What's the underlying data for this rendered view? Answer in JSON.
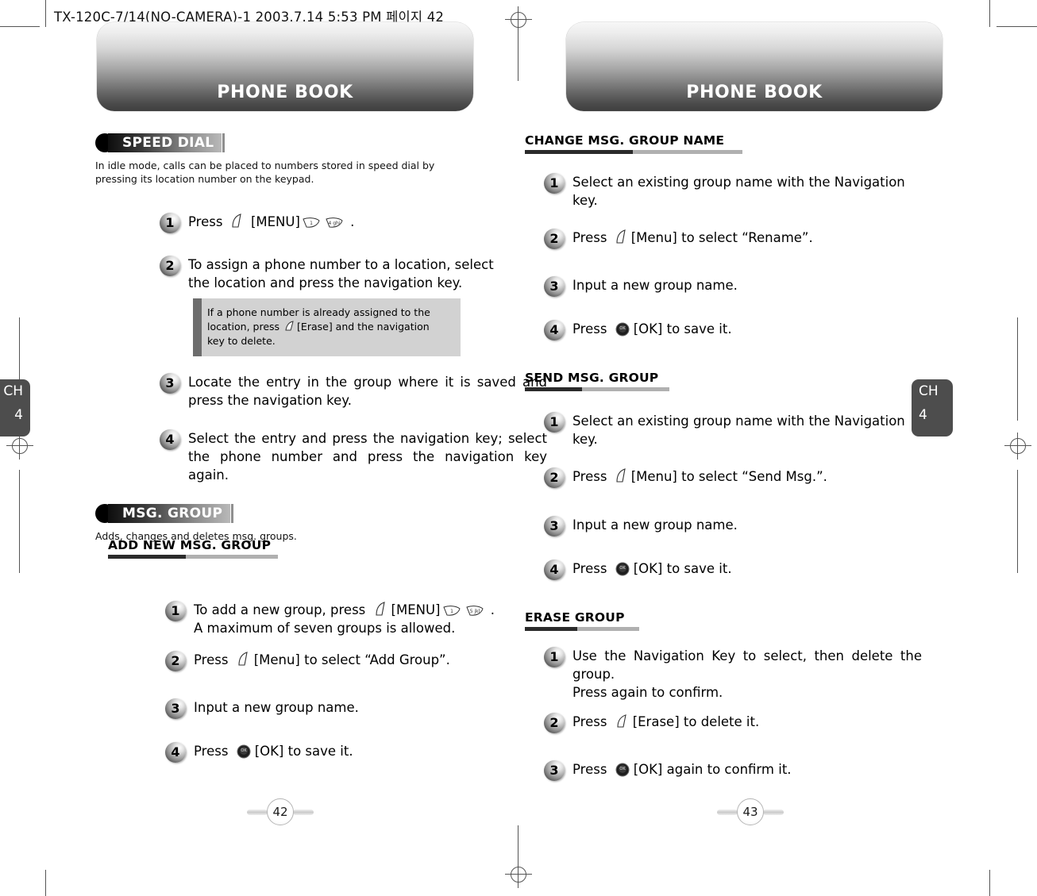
{
  "file_header": "TX-120C-7/14(NO-CAMERA)-1  2003.7.14 5:53 PM 페이지 42",
  "chapter_tab": {
    "label": "CH",
    "number": "4"
  },
  "left_page": {
    "banner_title": "PHONE BOOK",
    "page_number": "42",
    "sections": [
      {
        "kind": "main",
        "title": "SPEED DIAL",
        "description": "In idle mode, calls can be placed to numbers stored in speed dial by pressing its location number on the keypad.",
        "steps": [
          {
            "num": "1",
            "text_before": "Press",
            "icons": [
              "menu-key-icon",
              "key-1-icon",
              "key-4-icon"
            ],
            "text_after": ".",
            "full": "Press  [MENU]  ."
          },
          {
            "num": "2",
            "full": "To assign a phone number to a location, select the location and press the navigation key.",
            "note": "If a phone number is already assigned to the location, press  [Erase] and the navigation key to delete."
          },
          {
            "num": "3",
            "full": "Locate the entry in the group where it is saved and press the navigation key."
          },
          {
            "num": "4",
            "full": "Select the entry and press the navigation key; select the phone number and press the navigation key again."
          }
        ]
      },
      {
        "kind": "main",
        "title": "MSG. GROUP",
        "description": "Adds, changes and deletes msg. groups.",
        "sub_title": "ADD NEW MSG. GROUP",
        "steps": [
          {
            "num": "1",
            "full": "To add a new group, press  [MENU]  .\nA maximum of seven groups is allowed."
          },
          {
            "num": "2",
            "full": "Press  [Menu] to select “Add Group”."
          },
          {
            "num": "3",
            "full": "Input a new group name."
          },
          {
            "num": "4",
            "full": "Press  [OK] to save it."
          }
        ]
      }
    ]
  },
  "right_page": {
    "banner_title": "PHONE BOOK",
    "page_number": "43",
    "sections": [
      {
        "kind": "sub",
        "title": "CHANGE MSG. GROUP NAME",
        "steps": [
          {
            "num": "1",
            "full": "Select an existing group name with the Navigation key."
          },
          {
            "num": "2",
            "full": "Press  [Menu] to select “Rename”."
          },
          {
            "num": "3",
            "full": "Input a new group name."
          },
          {
            "num": "4",
            "full": "Press  [OK] to save it."
          }
        ]
      },
      {
        "kind": "sub",
        "title": "SEND MSG. GROUP",
        "steps": [
          {
            "num": "1",
            "full": "Select an existing group name with the Navigation key."
          },
          {
            "num": "2",
            "full": "Press  [Menu] to select “Send Msg.”."
          },
          {
            "num": "3",
            "full": "Input a new group name."
          },
          {
            "num": "4",
            "full": "Press  [OK] to save it."
          }
        ]
      },
      {
        "kind": "sub",
        "title": "ERASE GROUP",
        "steps": [
          {
            "num": "1",
            "full": "Use the Navigation Key to select, then delete the group.\nPress again to confirm."
          },
          {
            "num": "2",
            "full": "Press  [Erase] to delete it."
          },
          {
            "num": "3",
            "full": "Press  [OK] again to confirm it."
          }
        ]
      }
    ]
  },
  "text": {
    "press": "Press",
    "menu_bracket": "[MENU]",
    "menu_bracket_lc": "[Menu]",
    "ok_bracket": "[OK]",
    "erase_bracket": "[Erase]",
    "period": ".",
    "speed_dial_step1_tail": ".",
    "add_group_line1_a": "To add a new group, press",
    "add_group_line1_b": "[MENU]",
    "add_group_line1_c": ".",
    "add_group_line2": "A maximum of seven groups is allowed.",
    "s1_add_group_tail": "to select “Add Group”.",
    "s1_rename_tail": "to select “Rename”.",
    "s1_sendmsg_tail": "to select “Send Msg.”.",
    "to_save_it": "to save it.",
    "to_delete_it": "to delete it.",
    "again_confirm": "again to confirm it.",
    "input_group": "Input a new group name.",
    "select_existing": "Select an existing group name with the Navigation key.",
    "step2_assign": "To assign a phone number to a location, select the location and press the navigation key.",
    "step3_locate": "Locate the entry in the group where it is saved and press the navigation key.",
    "step4_select": "Select the entry and press the navigation key; select the phone number and press the navigation key again.",
    "note_a": "If a phone number is already assigned to the",
    "note_b": "location, press",
    "note_c": "[Erase] and the navigation",
    "note_d": "key to delete.",
    "erase1_a": "Use the Navigation Key to select, then delete the group.",
    "erase1_b": "Press again to confirm."
  },
  "colors": {
    "banner_dark": "#3f3f3f",
    "tab_gray": "#4d4d4d",
    "note_bg": "#d2d2d2",
    "note_bar": "#6d6d6d",
    "rule_dark": "#2b2b2b",
    "rule_light": "#b0b0b0"
  }
}
